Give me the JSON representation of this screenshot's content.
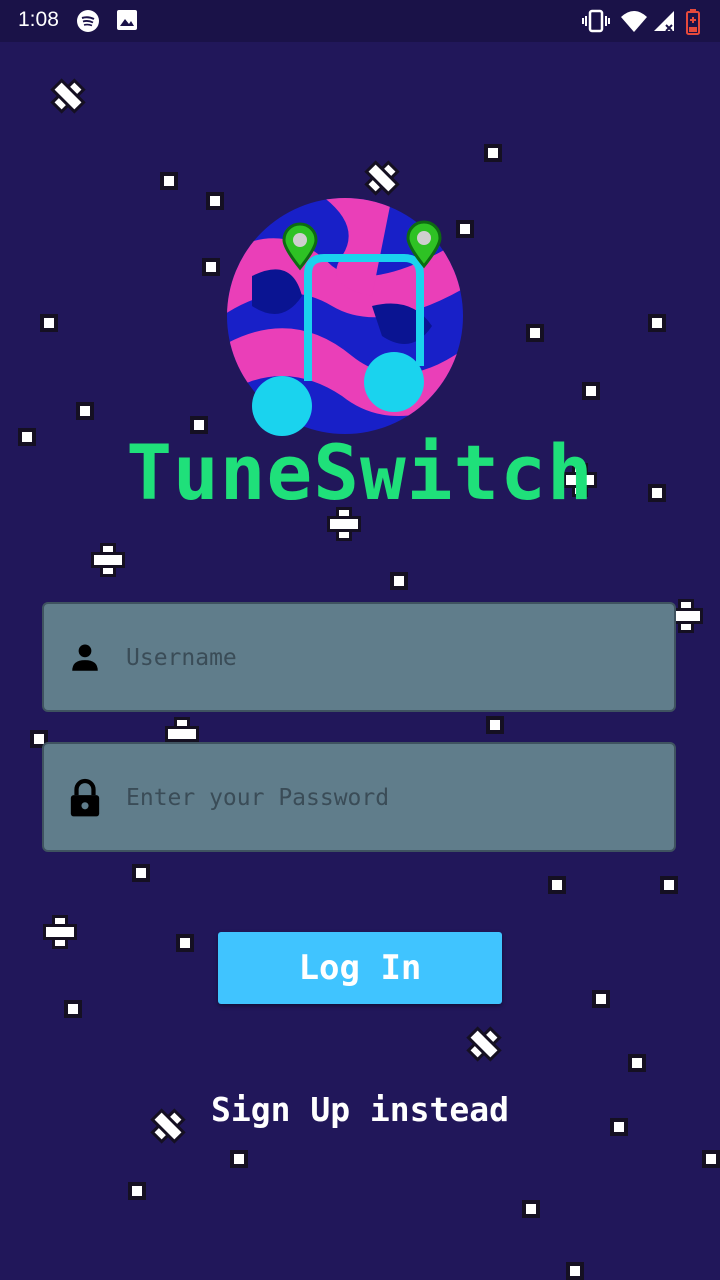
{
  "status_bar": {
    "time": "1:08",
    "left_icons": [
      "spotify-icon",
      "image-icon"
    ],
    "right_icons": [
      "vibrate-icon",
      "wifi-icon",
      "cell-signal-icon",
      "battery-icon"
    ]
  },
  "app": {
    "title": "TuneSwitch"
  },
  "username": {
    "placeholder": "Username",
    "value": ""
  },
  "password": {
    "placeholder": "Enter your Password",
    "value": ""
  },
  "actions": {
    "login_label": "Log In",
    "signup_label": "Sign Up instead"
  },
  "colors": {
    "background": "#21175a",
    "title": "#1fe07a",
    "field_bg": "#607d8b",
    "button_bg": "#40c4ff"
  }
}
